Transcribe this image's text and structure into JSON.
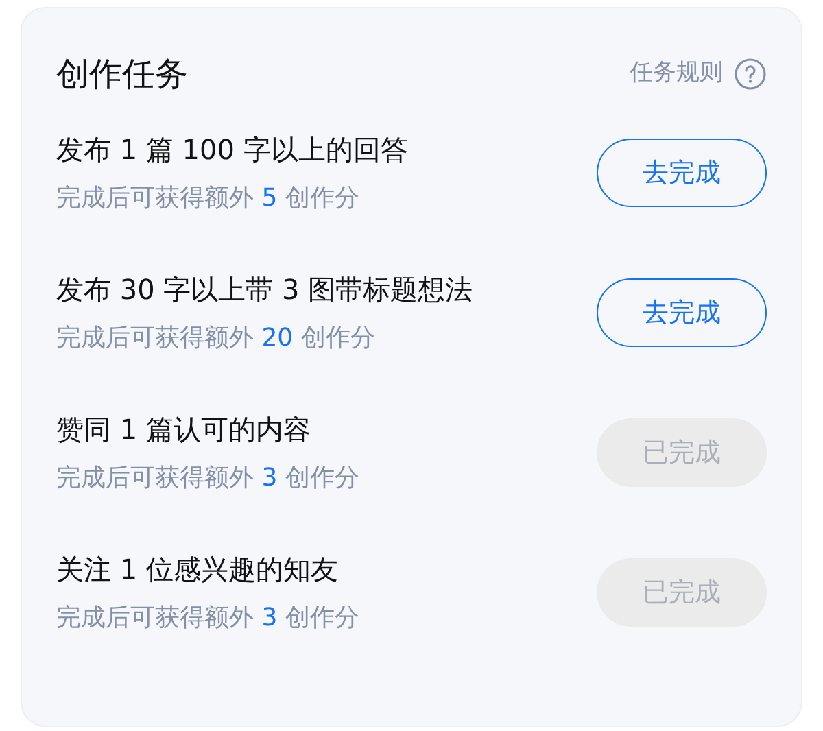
{
  "header": {
    "title": "创作任务",
    "rules_link": "任务规则"
  },
  "tasks": [
    {
      "title": "发布 1 篇 100 字以上的回答",
      "reward_prefix": "完成后可获得额外",
      "points": "5",
      "reward_suffix": "创作分",
      "button": "去完成",
      "completed": false
    },
    {
      "title": "发布 30 字以上带 3 图带标题想法",
      "reward_prefix": "完成后可获得额外",
      "points": "20",
      "reward_suffix": "创作分",
      "button": "去完成",
      "completed": false
    },
    {
      "title": "赞同 1 篇认可的内容",
      "reward_prefix": "完成后可获得额外",
      "points": "3",
      "reward_suffix": "创作分",
      "button": "已完成",
      "completed": true
    },
    {
      "title": "关注 1 位感兴趣的知友",
      "reward_prefix": "完成后可获得额外",
      "points": "3",
      "reward_suffix": "创作分",
      "button": "已完成",
      "completed": true
    }
  ]
}
